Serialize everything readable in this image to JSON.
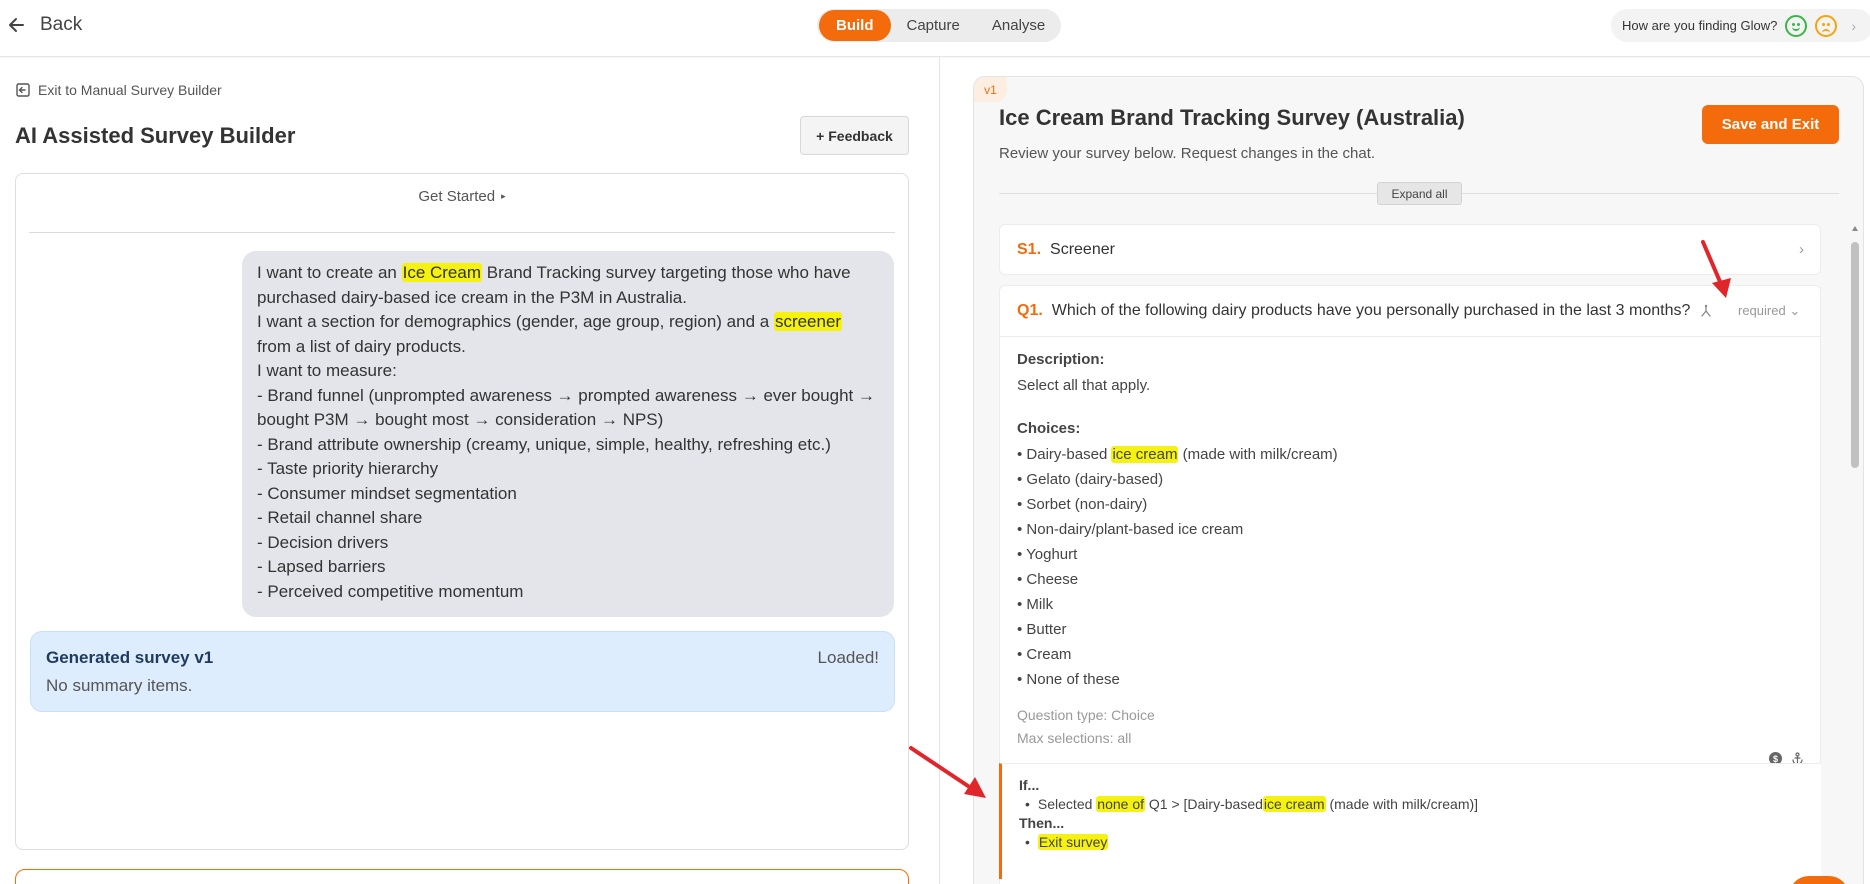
{
  "header": {
    "back_label": "Back",
    "tabs": [
      {
        "label": "Build",
        "active": true
      },
      {
        "label": "Capture",
        "active": false
      },
      {
        "label": "Analyse",
        "active": false
      }
    ],
    "feedback_prompt": "How are you finding Glow?"
  },
  "left": {
    "exit_link": "Exit to Manual Survey Builder",
    "title": "AI Assisted Survey Builder",
    "feedback_button": "+ Feedback",
    "get_started": "Get Started",
    "user_message": {
      "line1_pre": "I want to create an ",
      "line1_hl": "Ice Cream",
      "line1_post": " Brand Tracking survey targeting those who have purchased dairy-based ice cream in the P3M in Australia.",
      "line2_pre": "I want a section for demographics (gender, age group, region) and a ",
      "line2_hl": "screener",
      "line2_post": " from a list of dairy products.",
      "line3": "I want to measure:",
      "bullets": [
        "- Brand funnel (unprompted awareness → prompted awareness → ever bought → bought P3M → bought most → consideration → NPS)",
        "- Brand attribute ownership (creamy, unique, simple, healthy, refreshing etc.)",
        "- Taste priority hierarchy",
        "- Consumer mindset segmentation",
        "- Retail channel share",
        "- Decision drivers",
        "- Lapsed barriers",
        "- Perceived competitive momentum"
      ]
    },
    "generated": {
      "title": "Generated survey v1",
      "subtitle": "No summary items.",
      "status": "Loaded!"
    }
  },
  "right": {
    "version_badge": "v1",
    "survey_title": "Ice Cream Brand Tracking Survey (Australia)",
    "survey_subtitle": "Review your survey below. Request changes in the chat.",
    "save_button": "Save and Exit",
    "expand_all": "Expand all",
    "section": {
      "num": "S1.",
      "title": "Screener"
    },
    "question": {
      "num": "Q1.",
      "text": "Which of the following dairy products have you personally purchased in the last 3 months?",
      "required_label": "required",
      "description_label": "Description:",
      "description": "Select all that apply.",
      "choices_label": "Choices:",
      "choice1_pre": "• Dairy-based ",
      "choice1_hl": "ice cream",
      "choice1_post": " (made with milk/cream)",
      "choices": [
        "• Gelato (dairy-based)",
        "• Sorbet (non-dairy)",
        "• Non-dairy/plant-based ice cream",
        "• Yoghurt",
        "• Cheese",
        "• Milk",
        "• Butter",
        "• Cream",
        "• None of these"
      ],
      "question_type": "Question type: Choice",
      "max_selections": "Max selections: all"
    },
    "logic": {
      "if_label": "If...",
      "cond_pre": "Selected ",
      "cond_hl1": "none of",
      "cond_mid": " Q1 > [Dairy-based",
      "cond_hl2": "ice cream",
      "cond_post": " (made with milk/cream)]",
      "then_label": "Then...",
      "action_hl": "Exit survey"
    }
  },
  "colors": {
    "accent": "#f46b0b",
    "highlight": "#f5f20f",
    "generated_bg": "#deedfd",
    "annotation_arrow": "#e0262b"
  }
}
